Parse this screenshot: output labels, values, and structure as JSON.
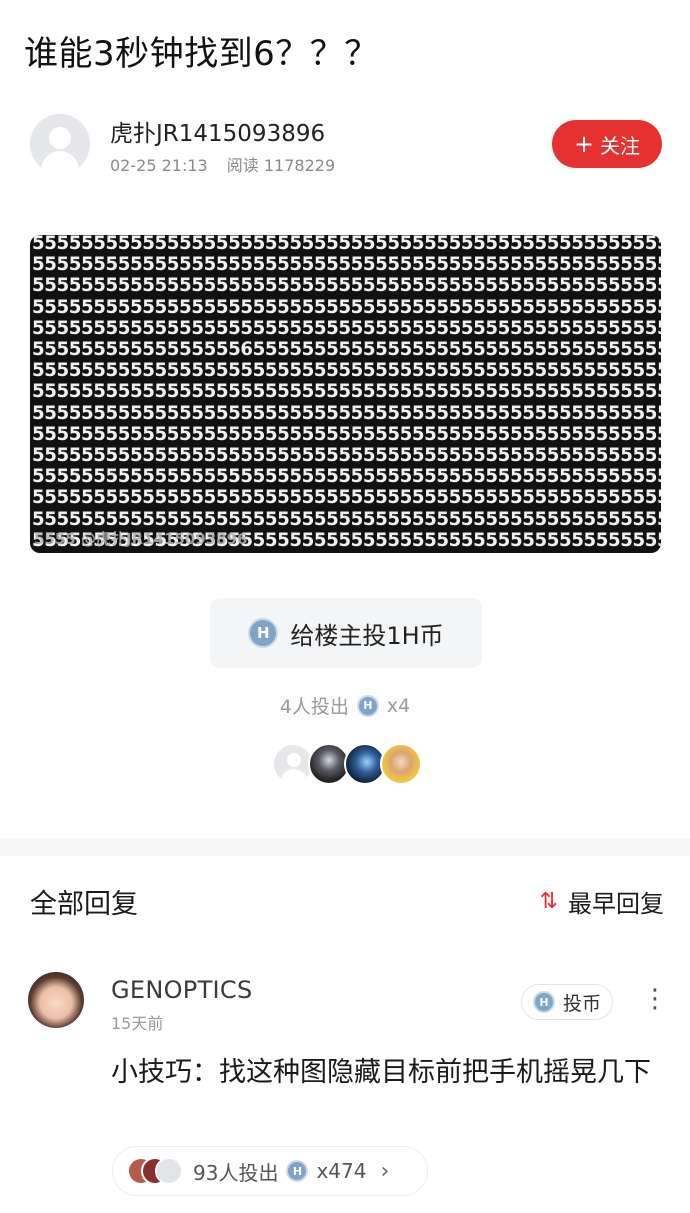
{
  "post": {
    "title": "谁能3秒钟找到6？？？",
    "author": "虎扑JR1415093896",
    "date": "02-25 21:13",
    "read_label": "阅读 1178229",
    "follow_icon": "+",
    "follow_label": "关注",
    "puzzle_watermark": "5555 @虎扑JR1415093896"
  },
  "coin": {
    "button_label": "给楼主投1H币",
    "coin_icon_letter": "H",
    "count_prefix": "4人投出",
    "count_suffix": "x4"
  },
  "replies": {
    "title": "全部回复",
    "sort_icon": "⇅",
    "sort_label": "最早回复"
  },
  "comment": {
    "name": "GENOPTICS",
    "time": "15天前",
    "coin_label": "投币",
    "more_icon": "⋮",
    "text": "小技巧：找这种图隐藏目标前把手机摇晃几下",
    "votes_prefix": "93人投出",
    "votes_suffix": "x474",
    "chevron": "›"
  },
  "colors": {
    "accent_red": "#e5312f",
    "h_coin_blue": "#7fa4c9"
  }
}
